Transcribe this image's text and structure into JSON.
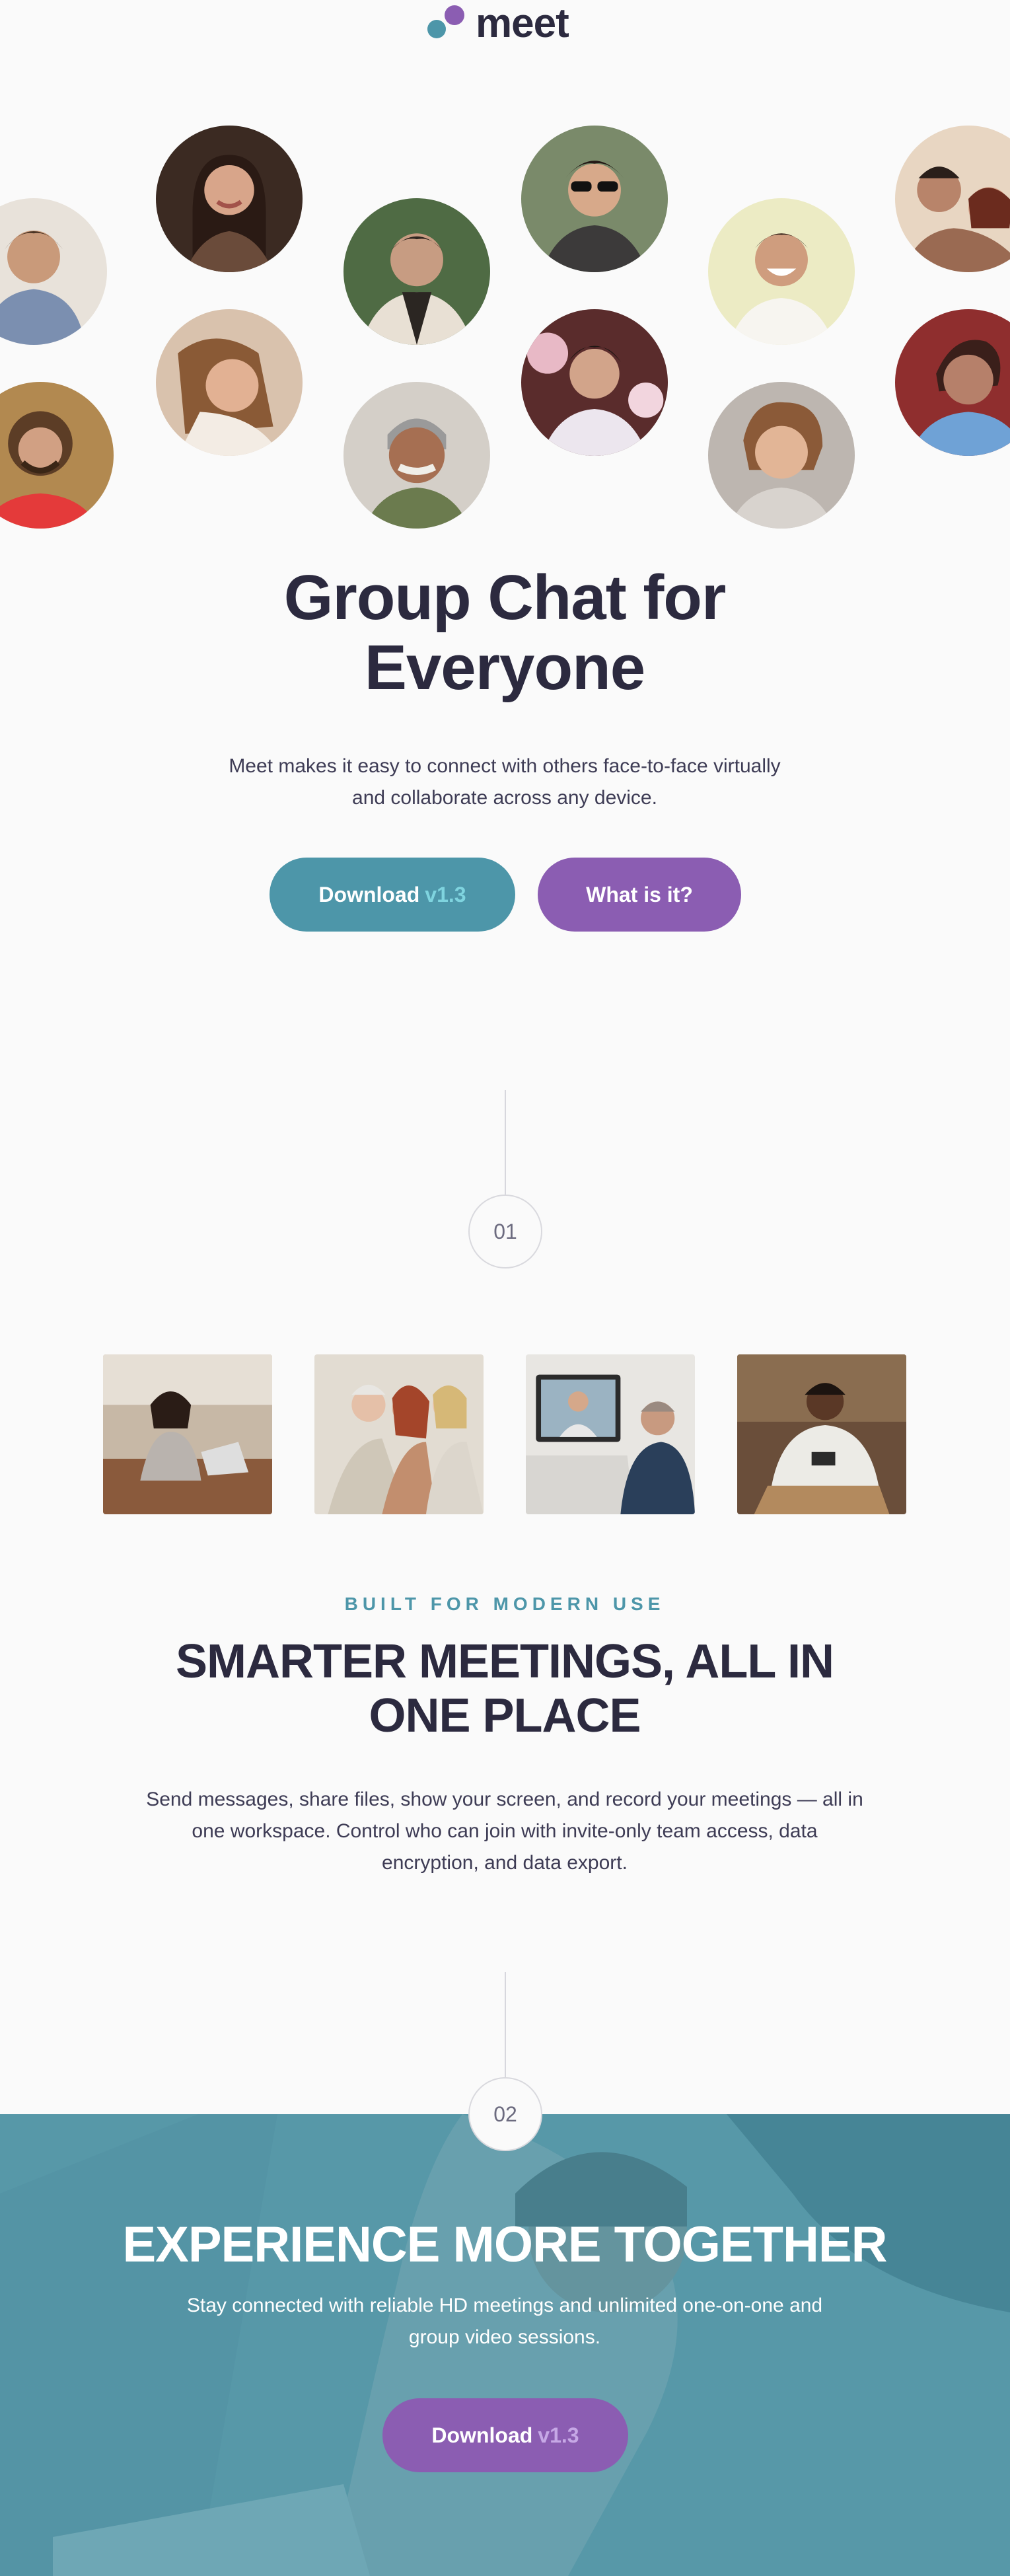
{
  "brand": {
    "name": "meet",
    "dot_primary": "#8b5db2",
    "dot_secondary": "#4d96a9"
  },
  "hero": {
    "title": "Group Chat for Everyone",
    "description": "Meet makes it easy to connect with others face-to-face virtually and collaborate across any device.",
    "download_label": "Download",
    "download_version": "v1.3",
    "what_label": "What is it?"
  },
  "steps": {
    "first": "01",
    "second": "02"
  },
  "features": {
    "eyebrow": "BUILT FOR MODERN USE",
    "title": "SMARTER MEETINGS, ALL IN ONE PLACE",
    "description": "Send messages, share files, show your screen, and record your meetings — all in one workspace. Control who can join with invite-only team access, data encryption, and data export."
  },
  "cta": {
    "title": "EXPERIENCE MORE TOGETHER",
    "description": "Stay connected with reliable HD meetings and unlimited one-on-one and group video sessions.",
    "download_label": "Download",
    "download_version": "v1.3"
  },
  "colors": {
    "accent_teal": "#4d96a9",
    "accent_purple": "#8b5db2",
    "text_dark": "#2c2a3f"
  }
}
